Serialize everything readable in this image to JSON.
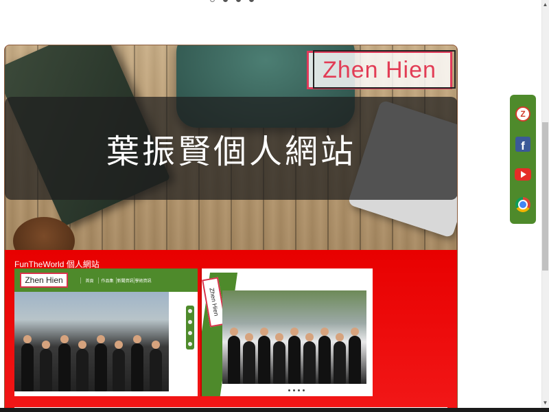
{
  "hero": {
    "logo_text": "Zhen Hien",
    "banner_title": "葉振賢個人網站"
  },
  "portfolio": {
    "section_label": "FunTheWorld 個人網站",
    "shot1": {
      "logo_text": "Zhen Hien",
      "nav_items": [
        "首頁",
        "作品集",
        "新聞資訊",
        "學術資訊"
      ]
    },
    "shot2": {
      "logo_text": "Zhen Hien"
    }
  },
  "social": {
    "items": [
      {
        "icon": "z-logo-icon"
      },
      {
        "icon": "facebook-icon",
        "glyph": "f"
      },
      {
        "icon": "youtube-icon"
      },
      {
        "icon": "chrome-icon"
      }
    ],
    "accent": "#4e8a2b"
  },
  "colors": {
    "red": "#e80000",
    "green": "#4e8a2b",
    "logo_pink": "#e23c55"
  },
  "carousel": {
    "count": 4,
    "active": 0
  }
}
